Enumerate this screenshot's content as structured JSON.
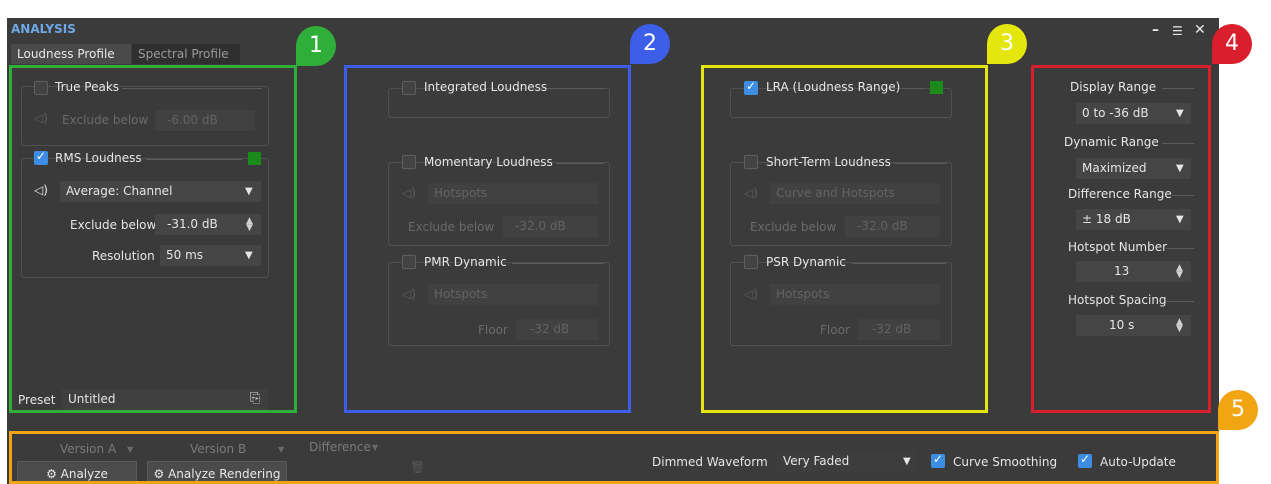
{
  "window": {
    "title": "ANALYSIS",
    "minimize_icon": "minimize-icon",
    "menu_icon": "panel-menu-icon",
    "close_icon": "close-icon"
  },
  "tabs": [
    {
      "label": "Loudness Profile",
      "active": true
    },
    {
      "label": "Spectral Profile",
      "active": false
    }
  ],
  "left": {
    "true_peaks": {
      "label": "True Peaks",
      "checked": false,
      "exclude_label": "Exclude below",
      "exclude_value": "-6.00 dB"
    },
    "rms": {
      "label": "RMS Loudness",
      "checked": true,
      "mode": "Average: Channel",
      "exclude_label": "Exclude below",
      "exclude_value": "-31.0 dB",
      "resolution_label": "Resolution",
      "resolution_value": "50 ms",
      "color": "#1a8a1a"
    },
    "preset_label": "Preset",
    "preset_value": "Untitled"
  },
  "middle": {
    "integrated": {
      "label": "Integrated Loudness",
      "checked": false
    },
    "momentary": {
      "label": "Momentary Loudness",
      "checked": false,
      "mode": "Hotspots",
      "exclude_label": "Exclude below",
      "exclude_value": "-32.0 dB"
    },
    "pmr": {
      "label": "PMR Dynamic",
      "checked": false,
      "mode": "Hotspots",
      "floor_label": "Floor",
      "floor_value": "-32 dB"
    }
  },
  "right": {
    "lra": {
      "label": "LRA (Loudness Range)",
      "checked": true,
      "color": "#1a8a1a"
    },
    "short_term": {
      "label": "Short-Term Loudness",
      "checked": false,
      "mode": "Curve and Hotspots",
      "exclude_label": "Exclude below",
      "exclude_value": "-32.0 dB"
    },
    "psr": {
      "label": "PSR Dynamic",
      "checked": false,
      "mode": "Hotspots",
      "floor_label": "Floor",
      "floor_value": "-32 dB"
    }
  },
  "display": {
    "display_range_label": "Display Range",
    "display_range_value": "0 to -36 dB",
    "dynamic_range_label": "Dynamic Range",
    "dynamic_range_value": "Maximized",
    "difference_range_label": "Difference Range",
    "difference_range_value": "± 18 dB",
    "hotspot_number_label": "Hotspot Number",
    "hotspot_number_value": "13",
    "hotspot_spacing_label": "Hotspot Spacing",
    "hotspot_spacing_value": "10 s"
  },
  "bottom": {
    "version_a": "Version A",
    "version_b": "Version B",
    "difference": "Difference",
    "analyze": "Analyze",
    "analyze_rendering": "Analyze Rendering",
    "dimmed_waveform_label": "Dimmed Waveform",
    "dimmed_waveform_value": "Very Faded",
    "curve_smoothing": {
      "label": "Curve Smoothing",
      "checked": true
    },
    "auto_update": {
      "label": "Auto-Update",
      "checked": true
    }
  },
  "callouts": [
    {
      "number": "1",
      "color": "#2fae3a"
    },
    {
      "number": "2",
      "color": "#3d5ee8"
    },
    {
      "number": "3",
      "color": "#e6e60f"
    },
    {
      "number": "4",
      "color": "#d91e2e"
    },
    {
      "number": "5",
      "color": "#f2a512"
    }
  ]
}
